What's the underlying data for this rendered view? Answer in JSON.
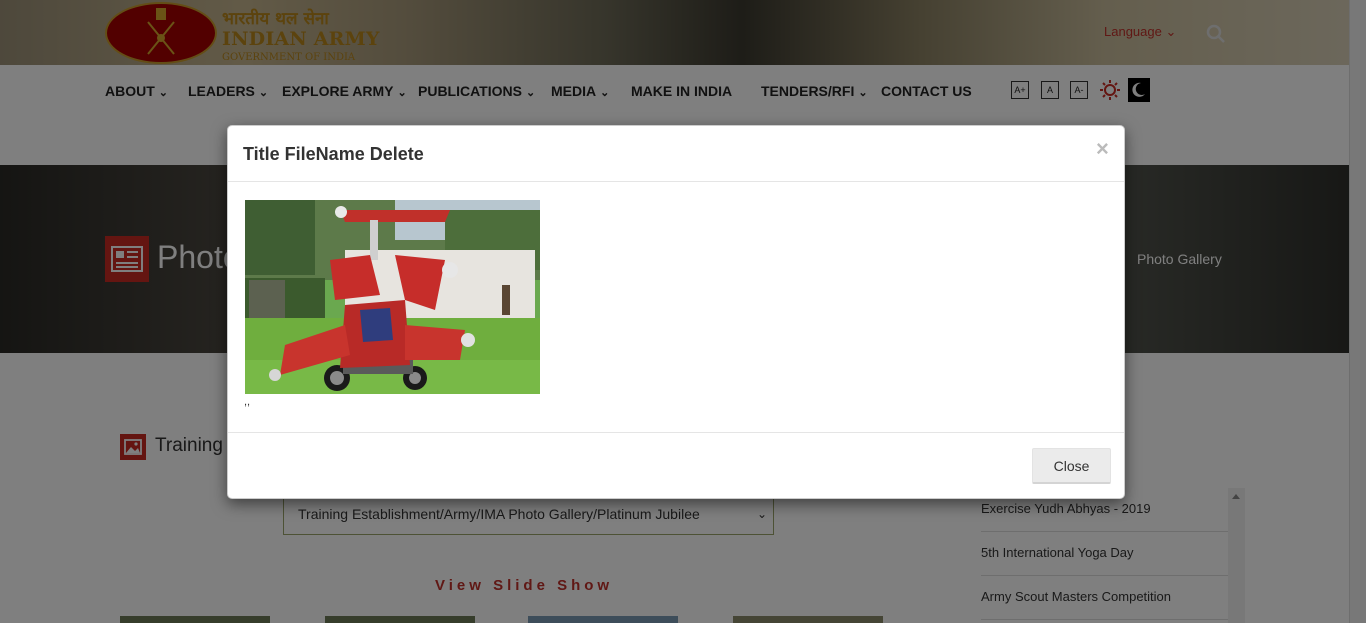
{
  "header": {
    "logo_hindi": "भारतीय थल सेना",
    "logo_english": "INDIAN ARMY",
    "logo_subtitle": "GOVERNMENT OF INDIA",
    "language_label": "Language",
    "search_icon": "search-icon"
  },
  "nav": {
    "items": [
      {
        "label": "ABOUT",
        "dropdown": true
      },
      {
        "label": "LEADERS",
        "dropdown": true
      },
      {
        "label": "EXPLORE ARMY",
        "dropdown": true
      },
      {
        "label": "PUBLICATIONS",
        "dropdown": true
      },
      {
        "label": "MEDIA",
        "dropdown": true
      },
      {
        "label": "MAKE IN INDIA",
        "dropdown": false
      },
      {
        "label": "TENDERS/RFI",
        "dropdown": true
      },
      {
        "label": "CONTACT US",
        "dropdown": false
      }
    ],
    "accessibility": {
      "increase_font": "A+",
      "normal_font": "A",
      "decrease_font": "A-",
      "light_theme_icon": "sun-icon",
      "dark_theme_icon": "moon-icon"
    }
  },
  "banner": {
    "title": "Photo",
    "breadcrumb": "Photo Gallery"
  },
  "section": {
    "title": "Training",
    "path_select_value": "Training Establishment/Army/IMA Photo Gallery/Platinum Jubilee",
    "slide_show_label": "View Slide Show"
  },
  "sidebar": {
    "items": [
      {
        "label": "Exercise Yudh Abhyas - 2019"
      },
      {
        "label": "5th International Yoga Day"
      },
      {
        "label": "Army Scout Masters Competition"
      }
    ]
  },
  "modal": {
    "title": "Title FileName Delete",
    "close_x": "×",
    "caption": ",,",
    "close_button_label": "Close"
  },
  "colors": {
    "accent_red": "#c82a22",
    "logo_gold": "#b8861b",
    "overlay": "rgba(0,0,0,0.5)"
  }
}
